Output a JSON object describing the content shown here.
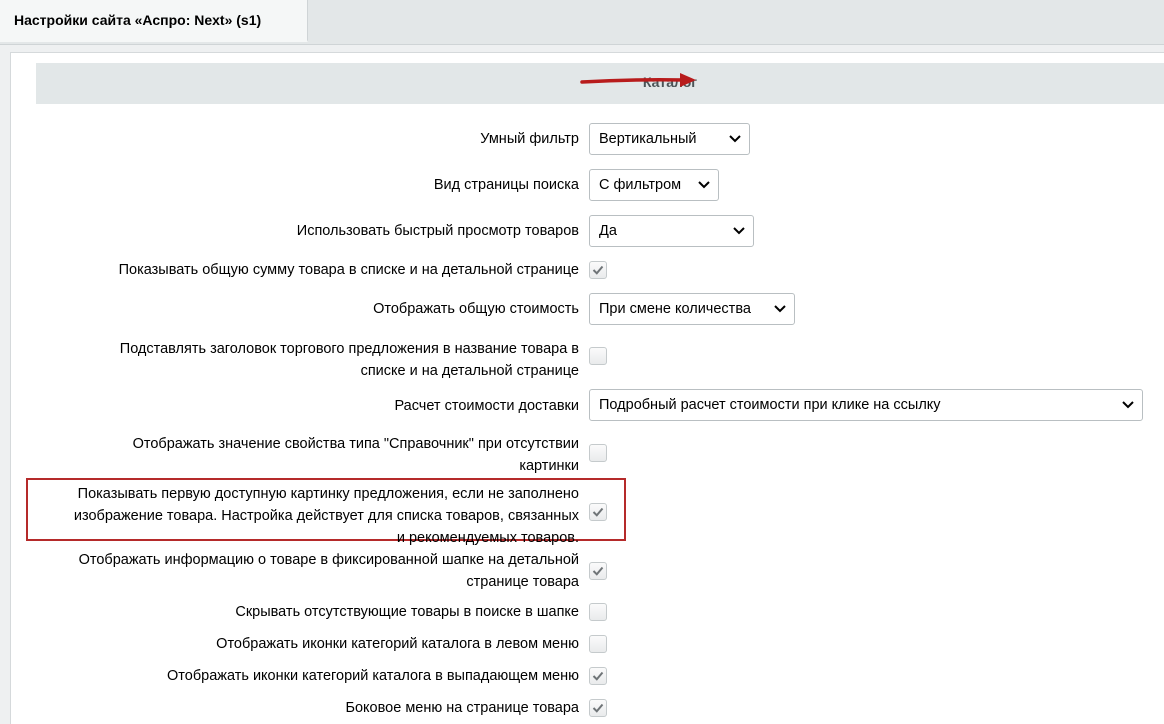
{
  "tab": {
    "title": "Настройки сайта «Аспро: Next» (s1)"
  },
  "section": {
    "title": "Каталог"
  },
  "colors": {
    "accent_arrow": "#b81c1c",
    "highlight_border": "#b52a2a",
    "header_bg": "#e2e7e8"
  },
  "rows": {
    "smart_filter": {
      "label": "Умный фильтр",
      "value": "Вертикальный"
    },
    "search_view": {
      "label": "Вид страницы поиска",
      "value": "С фильтром"
    },
    "quick_view": {
      "label": "Использовать быстрый просмотр товаров",
      "value": "Да"
    },
    "total_sum": {
      "label": "Показывать общую сумму товара в списке и на детальной странице",
      "checked": true
    },
    "total_cost": {
      "label": "Отображать общую стоимость",
      "value": "При смене количества"
    },
    "offer_title": {
      "label_line1": "Подставлять заголовок торгового предложения в название товара в",
      "label_line2": "списке и на детальной странице",
      "checked": false
    },
    "delivery_calc": {
      "label": "Расчет стоимости доставки",
      "value": "Подробный расчет стоимости при клике на ссылку"
    },
    "directory_value": {
      "label_line1": "Отображать значение свойства типа \"Справочник\" при отсутствии",
      "label_line2": "картинки",
      "checked": false
    },
    "first_offer_image": {
      "label_line1": "Показывать первую доступную картинку предложения, если не заполнено",
      "label_line2": "изображение товара. Настройка действует для списка товаров, связанных",
      "label_line3": "и рекомендуемых товаров.",
      "checked": true
    },
    "fixed_header_info": {
      "label_line1": "Отображать информацию о товаре в фиксированной шапке на детальной",
      "label_line2": "странице товара",
      "checked": true
    },
    "hide_absent": {
      "label": "Скрывать отсутствующие товары в поиске в шапке",
      "checked": false
    },
    "icons_left_menu": {
      "label": "Отображать иконки категорий каталога в левом меню",
      "checked": false
    },
    "icons_dropdown": {
      "label": "Отображать иконки категорий каталога в выпадающем меню",
      "checked": true
    },
    "side_menu": {
      "label": "Боковое меню на странице товара",
      "checked": true
    }
  }
}
